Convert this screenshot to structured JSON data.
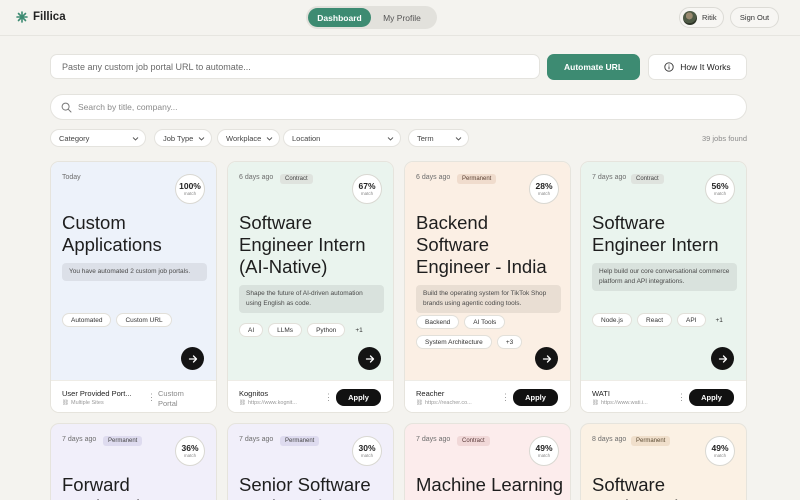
{
  "app": {
    "name": "Fillica"
  },
  "nav": {
    "tabs": [
      "Dashboard",
      "My Profile"
    ]
  },
  "user": {
    "name": "Ritik",
    "signout": "Sign Out"
  },
  "automate": {
    "placeholder": "Paste any custom job portal URL to automate...",
    "button": "Automate URL",
    "how": "How It Works"
  },
  "search": {
    "placeholder": "Search by title, company..."
  },
  "filters": [
    "Category",
    "Job Type",
    "Workplace",
    "Location",
    "Term"
  ],
  "jobs_found": "39 jobs found",
  "colors": {
    "accent": "#3d8b72",
    "dark": "#111111"
  },
  "cards": [
    {
      "time": "Today",
      "badge": "",
      "match": "100%",
      "match_label": "match",
      "title": "Custom Applications",
      "desc": "You have automated 2 custom job portals.",
      "tags": [
        "Automated",
        "Custom URL"
      ],
      "more": "",
      "company": "User Provided Port...",
      "url": "Multiple Sites",
      "side": "Custom Portal",
      "apply": ""
    },
    {
      "time": "6 days ago",
      "badge": "Contract",
      "match": "67%",
      "match_label": "match",
      "title": "Software Engineer Intern (AI-Native)",
      "desc": "Shape the future of AI-driven automation using English as code.",
      "tags": [
        "AI",
        "LLMs",
        "Python"
      ],
      "more": "+1",
      "company": "Kognitos",
      "url": "https://www.kognit...",
      "side": "",
      "apply": "Apply"
    },
    {
      "time": "6 days ago",
      "badge": "Permanent",
      "match": "28%",
      "match_label": "match",
      "title": "Backend Software Engineer - India",
      "desc": "Build the operating system for TikTok Shop brands using agentic coding tools.",
      "tags": [
        "Backend",
        "AI Tools",
        "System Architecture"
      ],
      "more": "+3",
      "company": "Reacher",
      "url": "https://reacher.co...",
      "side": "",
      "apply": "Apply"
    },
    {
      "time": "7 days ago",
      "badge": "Contract",
      "match": "56%",
      "match_label": "match",
      "title": "Software Engineer Intern",
      "desc": "Help build our core conversational commerce platform and API integrations.",
      "tags": [
        "Node.js",
        "React",
        "API"
      ],
      "more": "+1",
      "company": "WATI",
      "url": "https://www.wati.i...",
      "side": "",
      "apply": "Apply"
    },
    {
      "time": "7 days ago",
      "badge": "Permanent",
      "match": "36%",
      "match_label": "match",
      "title": "Forward Deployed..."
    },
    {
      "time": "7 days ago",
      "badge": "Permanent",
      "match": "30%",
      "match_label": "match",
      "title": "Senior Software Engineer in Test"
    },
    {
      "time": "7 days ago",
      "badge": "Contract",
      "match": "49%",
      "match_label": "match",
      "title": "Machine Learning Intern"
    },
    {
      "time": "8 days ago",
      "badge": "Permanent",
      "match": "49%",
      "match_label": "match",
      "title": "Software Engineer (AI &..."
    }
  ]
}
